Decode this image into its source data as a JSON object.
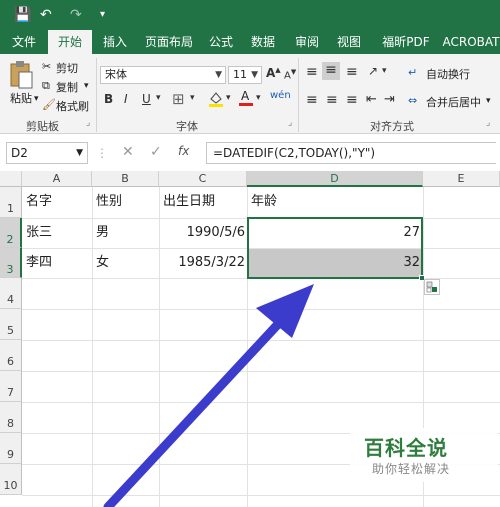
{
  "quick_access": {
    "save": "💾",
    "undo": "↶",
    "redo": "↷"
  },
  "tabs": [
    {
      "label": "文件"
    },
    {
      "label": "开始"
    },
    {
      "label": "插入"
    },
    {
      "label": "页面布局"
    },
    {
      "label": "公式"
    },
    {
      "label": "数据"
    },
    {
      "label": "审阅"
    },
    {
      "label": "视图"
    },
    {
      "label": "福昕PDF"
    },
    {
      "label": "ACROBAT"
    }
  ],
  "clipboard": {
    "paste": "粘贴",
    "cut": "剪切",
    "copy": "复制",
    "format_painter": "格式刷",
    "group": "剪贴板"
  },
  "font": {
    "name": "宋体",
    "size": "11",
    "bold": "B",
    "italic": "I",
    "underline": "U",
    "group": "字体"
  },
  "alignment": {
    "wrap": "自动换行",
    "merge": "合并后居中",
    "group": "对齐方式"
  },
  "formula_bar": {
    "cell_ref": "D2",
    "fx": "fx",
    "formula": "=DATEDIF(C2,TODAY(),\"Y\")"
  },
  "columns": [
    "A",
    "B",
    "C",
    "D",
    "E"
  ],
  "rows": [
    "1",
    "2",
    "3",
    "4",
    "5",
    "6",
    "7",
    "8",
    "9",
    "10"
  ],
  "table": {
    "header": [
      "名字",
      "性别",
      "出生日期",
      "年龄"
    ],
    "rows": [
      [
        "张三",
        "男",
        "1990/5/6",
        "27"
      ],
      [
        "李四",
        "女",
        "1985/3/22",
        "32"
      ]
    ]
  },
  "watermark": {
    "title": "百科全说",
    "subtitle": "助你轻松解决"
  },
  "colors": {
    "accent": "#217346",
    "arrow": "#3b3bcc"
  }
}
